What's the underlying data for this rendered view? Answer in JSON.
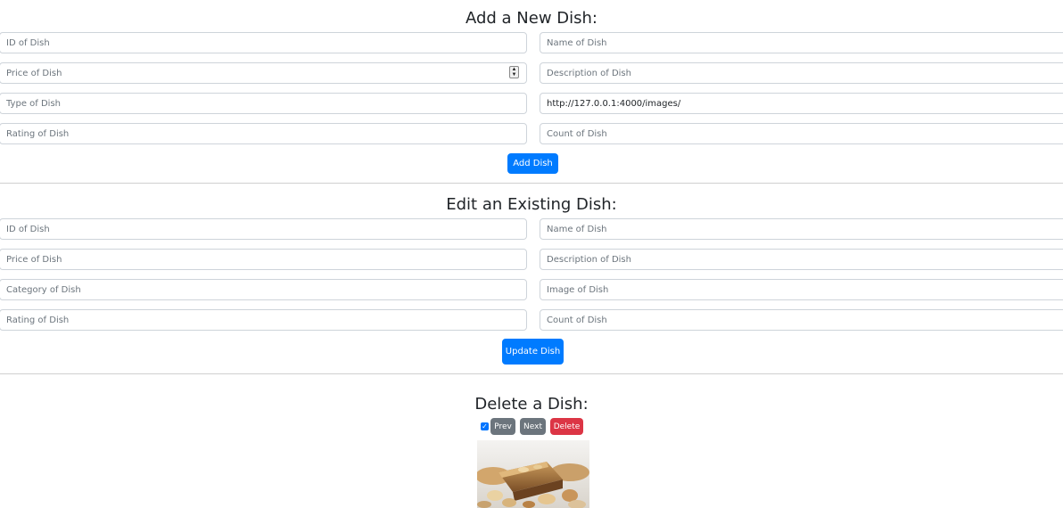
{
  "add_section": {
    "title": "Add a New Dish:",
    "fields": {
      "id_placeholder": "ID of Dish",
      "name_placeholder": "Name of Dish",
      "price_placeholder": "Price of Dish",
      "description_placeholder": "Description of Dish",
      "type_placeholder": "Type of Dish",
      "image_value": "http://127.0.0.1:4000/images/",
      "rating_placeholder": "Rating of Dish",
      "count_placeholder": "Count of Dish"
    },
    "button_label": "Add Dish"
  },
  "edit_section": {
    "title": "Edit an Existing Dish:",
    "fields": {
      "id_placeholder": "ID of Dish",
      "name_placeholder": "Name of Dish",
      "price_placeholder": "Price of Dish",
      "description_placeholder": "Description of Dish",
      "category_placeholder": "Category of Dish",
      "image_placeholder": "Image of Dish",
      "rating_placeholder": "Rating of Dish",
      "count_placeholder": "Count of Dish"
    },
    "button_label": "Update Dish"
  },
  "delete_section": {
    "title": "Delete a Dish:",
    "checkbox_checked": true,
    "prev_label": "Prev",
    "next_label": "Next",
    "delete_label": "Delete"
  },
  "colors": {
    "primary": "#007bff",
    "secondary": "#6c757d",
    "danger": "#dc3545",
    "border": "#ced4da"
  }
}
